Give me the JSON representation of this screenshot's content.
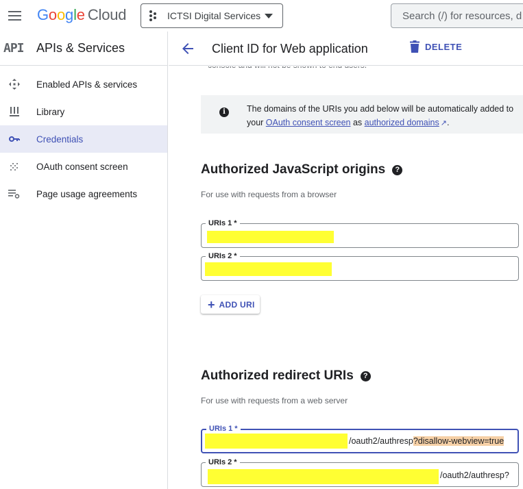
{
  "topbar": {
    "logo_google": [
      "G",
      "o",
      "o",
      "g",
      "l",
      "e"
    ],
    "logo_cloud": "Cloud",
    "project_name": "ICTSI Digital Services",
    "search_placeholder": "Search (/) for resources, d"
  },
  "sidebar": {
    "api_mark": "API",
    "title": "APIs & Services",
    "items": [
      {
        "label": "Enabled APIs & services",
        "icon": "enabled-apis-icon",
        "active": false
      },
      {
        "label": "Library",
        "icon": "library-icon",
        "active": false
      },
      {
        "label": "Credentials",
        "icon": "key-icon",
        "active": true
      },
      {
        "label": "OAuth consent screen",
        "icon": "oauth-consent-icon",
        "active": false
      },
      {
        "label": "Page usage agreements",
        "icon": "page-usage-icon",
        "active": false
      }
    ]
  },
  "header": {
    "title": "Client ID for Web application",
    "delete_label": "DELETE"
  },
  "content": {
    "clipped_text": "console and will not be shown to end users.",
    "info": {
      "line1": "The domains of the URIs you add below will be automatically added to",
      "line2_prefix": "your ",
      "link1": "OAuth consent screen",
      "line2_mid": " as ",
      "link2": "authorized domains",
      "line2_suffix": "."
    },
    "js_origins": {
      "title": "Authorized JavaScript origins",
      "desc": "For use with requests from a browser",
      "fields": [
        {
          "label": "URIs 1 *"
        },
        {
          "label": "URIs 2 *"
        }
      ],
      "add_label": "ADD URI"
    },
    "redirect": {
      "title": "Authorized redirect URIs",
      "desc": "For use with requests from a web server",
      "fields": [
        {
          "label": "URIs 1 *",
          "suffix": "/oauth2/authresp",
          "highlight": "?disallow-webview=true"
        },
        {
          "label": "URIs 2 *",
          "suffix": "/oauth2/authresp?"
        }
      ]
    }
  },
  "colors": {
    "accent": "#3f51b5",
    "active_nav_bg": "#e8eaf6",
    "redaction": "#ffff33",
    "highlight": "#f6d0a6"
  }
}
